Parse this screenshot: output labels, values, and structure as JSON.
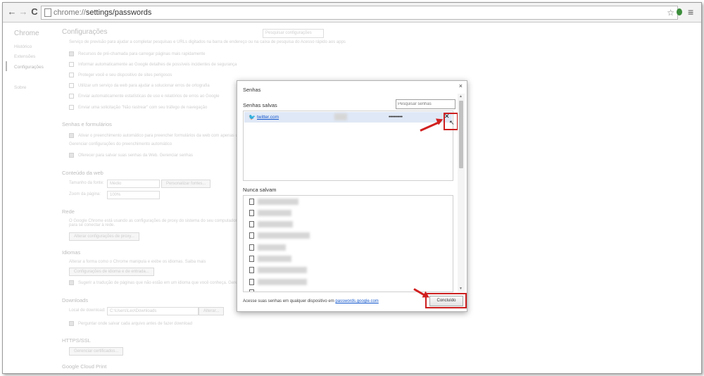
{
  "browser": {
    "url_scheme": "chrome://",
    "url_path": "settings/passwords",
    "back_glyph": "←",
    "forward_glyph": "→",
    "reload_glyph": "C",
    "star_glyph": "☆",
    "menu_glyph": "≡"
  },
  "settings": {
    "brand": "Chrome",
    "nav": [
      "Histórico",
      "Extensões",
      "Configurações",
      "Sobre"
    ],
    "title": "Configurações",
    "search_placeholder": "Pesquisar configurações",
    "privacy_lines": [
      "Serviço de previsão para ajudar a completar pesquisas e URLs digitados na barra de endereço ou na caixa de pesquisa do Acesso rápido aos apps",
      "Recursos de pré-chamada para carregar páginas mais rapidamente",
      "Informar automaticamente ao Google detalhes de possíveis incidentes de segurança",
      "Proteger você e seu dispositivo de sites perigosos",
      "Utilizar um serviço da web para ajudar a solucionar erros de ortografia",
      "Enviar automaticamente estatísticas de uso e relatórios de erros ao Google",
      "Enviar uma solicitação \"Não rastrear\" com seu tráfego de navegação"
    ],
    "passwords_heading": "Senhas e formulários",
    "autofill_line": "Ativar o preenchimento automático para preencher formulários da web com apenas um clique.",
    "autofill_link": "Gerenciar configurações do preenchimento automático",
    "offer_save_line": "Oferecer para salvar suas senhas da Web. Gerenciar senhas",
    "web_content_heading": "Conteúdo da web",
    "font_size_label": "Tamanho da fonte:",
    "font_size_value": "Médio",
    "customize_fonts_btn": "Personalizar fontes...",
    "zoom_label": "Zoom da página:",
    "zoom_value": "100%",
    "network_heading": "Rede",
    "network_text": "O Google Chrome está usando as configurações de proxy do sistema do seu computador para se conectar à rede.",
    "proxy_btn": "Alterar configurações de proxy...",
    "languages_heading": "Idiomas",
    "languages_text": "Alterar a forma como o Chrome manipula e exibe os idiomas. Saiba mais",
    "languages_btn": "Configurações de idioma e de entrada...",
    "translate_line": "Sugerir a tradução de páginas que não estão em um idioma que você conheça. Gerenciar idiomas",
    "downloads_heading": "Downloads",
    "download_location_label": "Local de download:",
    "download_location_value": "C:\\Users\\Leo\\Downloads",
    "change_btn": "Alterar...",
    "ask_save_line": "Perguntar onde salvar cada arquivo antes de fazer download",
    "https_heading": "HTTPS/SSL",
    "certificates_btn": "Gerenciar certificados...",
    "cloud_print_heading": "Google Cloud Print"
  },
  "dialog": {
    "title": "Senhas",
    "close_glyph": "×",
    "saved_heading": "Senhas salvas",
    "search_placeholder": "Pesquisar senhas",
    "saved_entries": [
      {
        "site": "twitter.com",
        "password_mask": "••••••••••",
        "icon": "twitter-bird-icon"
      }
    ],
    "remove_glyph": "✕",
    "never_heading": "Nunca salvam",
    "never_entries_count_visible": 10,
    "footer_text": "Acesse suas senhas em qualquer dispositivo em",
    "footer_link": "passwords.google.com",
    "done_label": "Concluído"
  },
  "colors": {
    "highlight_red": "#cc1f1f",
    "link_blue": "#1155cc",
    "selected_row": "#dfe8f6",
    "twitter_blue": "#1da1f2"
  }
}
